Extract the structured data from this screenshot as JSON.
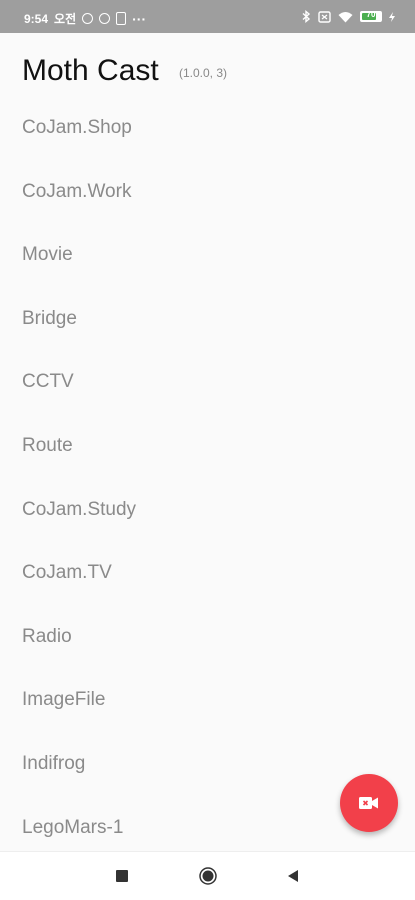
{
  "status_bar": {
    "time": "9:54",
    "ampm": "오전",
    "overflow": "···",
    "battery_level": "70"
  },
  "header": {
    "title": "Moth Cast",
    "version": "(1.0.0, 3)"
  },
  "menu": {
    "items": [
      {
        "label": "CoJam.Shop"
      },
      {
        "label": "CoJam.Work"
      },
      {
        "label": "Movie"
      },
      {
        "label": "Bridge"
      },
      {
        "label": "CCTV"
      },
      {
        "label": "Route"
      },
      {
        "label": "CoJam.Study"
      },
      {
        "label": "CoJam.TV"
      },
      {
        "label": "Radio"
      },
      {
        "label": "ImageFile"
      },
      {
        "label": "Indifrog"
      },
      {
        "label": "LegoMars-1"
      }
    ]
  },
  "fab": {
    "icon": "video-camera-icon",
    "color": "#f2404a"
  },
  "nav": {
    "recents_icon": "square-icon",
    "home_icon": "circle-icon",
    "back_icon": "triangle-back-icon"
  },
  "colors": {
    "status_bar_bg": "#9e9e9e",
    "background": "#fafafa",
    "title": "#111111",
    "item_text": "#8a8a8a",
    "battery_fill": "#4caf50"
  }
}
